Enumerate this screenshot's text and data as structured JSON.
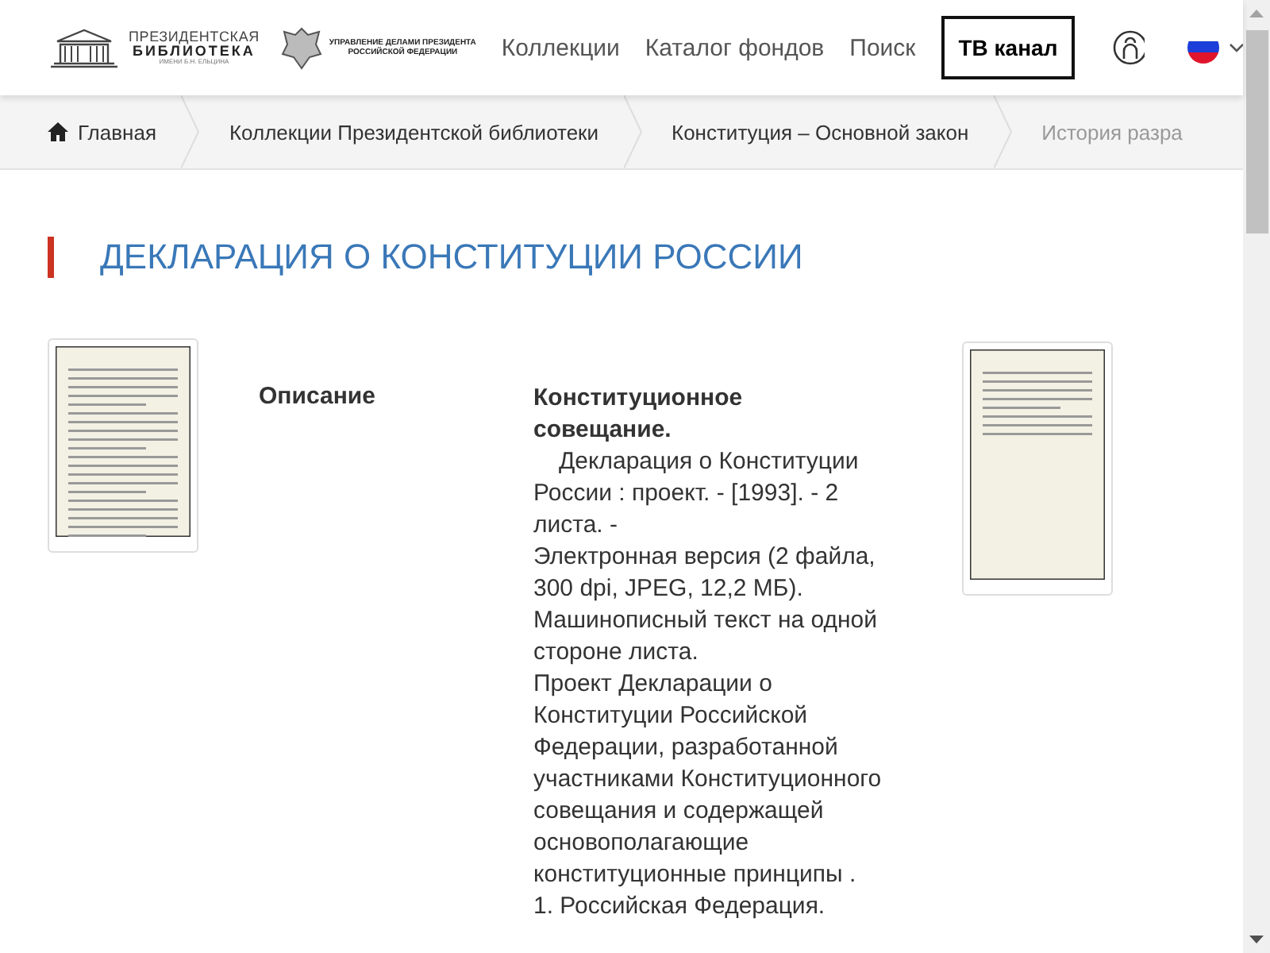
{
  "header": {
    "logo": {
      "line_1": "ПРЕЗИДЕНТСКАЯ",
      "line_2": "БИБЛИОТЕКА",
      "line_3": "ИМЕНИ Б.Н. ЕЛЬЦИНА"
    },
    "partner": {
      "line_1": "УПРАВЛЕНИЕ ДЕЛАМИ ПРЕЗИДЕНТА",
      "line_2": "РОССИЙСКОЙ ФЕДЕРАЦИИ"
    },
    "nav": [
      "Коллекции",
      "Каталог фондов",
      "Поиск"
    ],
    "tv_button": "ТВ канал"
  },
  "breadcrumbs": [
    {
      "label": "Главная",
      "kind": "home"
    },
    {
      "label": "Коллекции Президентской библиотеки",
      "kind": "link"
    },
    {
      "label": "Конституция – Основной закон",
      "kind": "link"
    },
    {
      "label": "История разра",
      "kind": "faded"
    }
  ],
  "title": "ДЕКЛАРАЦИЯ О КОНСТИТУЦИИ РОССИИ",
  "description": {
    "label": "Описание",
    "heading": "Конституционное совещание.",
    "paragraphs": [
      "Декларация о Конституции России : проект. - [1993]. - 2 листа. -",
      "Электронная версия (2 файла, 300 dpi, JPEG, 12,2 МБ).",
      "Машинописный текст на одной стороне листа.",
      "Проект Декларации о Конституции Российской Федерации, разработанной участниками Конституционного совещания и содержащей основополагающие конституционные принципы .",
      "1. Российская Федерация."
    ]
  }
}
